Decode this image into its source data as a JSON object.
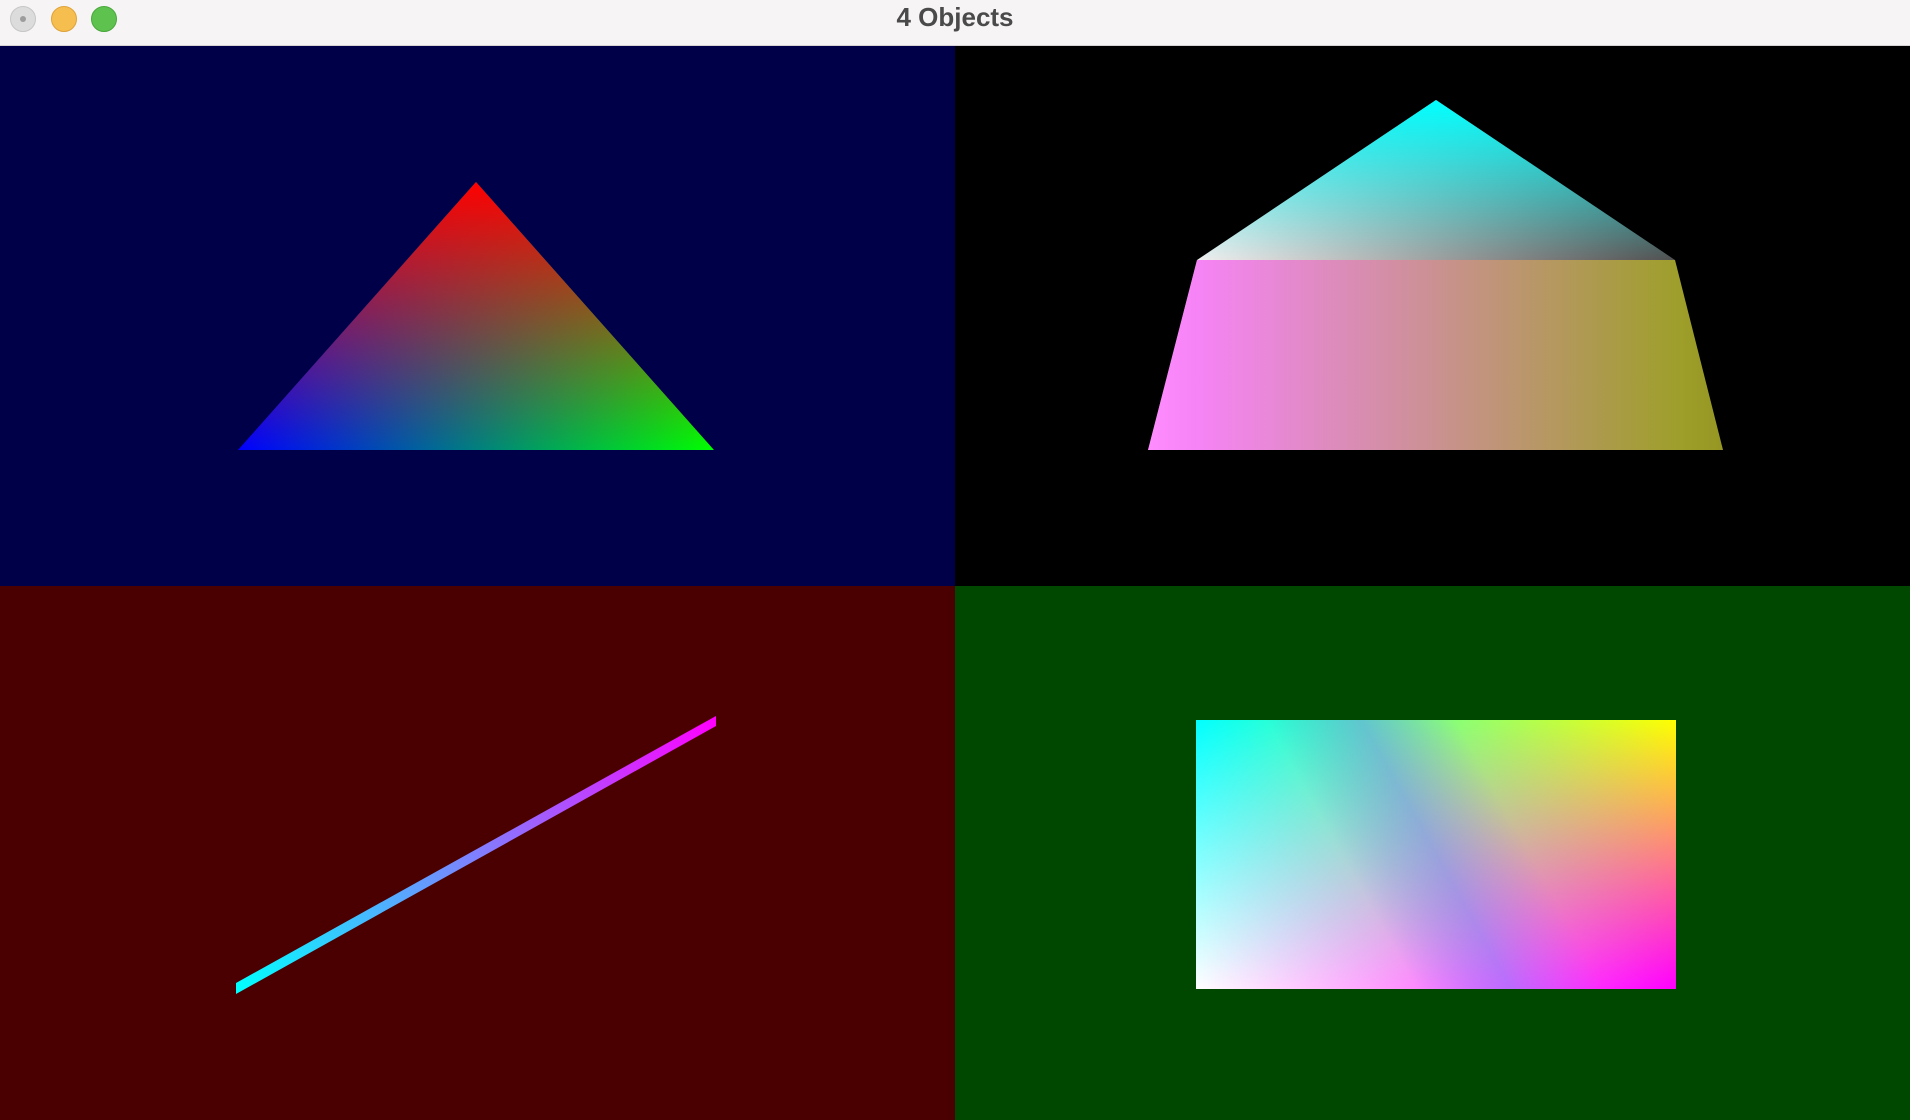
{
  "window": {
    "title": "4 Objects"
  },
  "viewports": [
    {
      "name": "triangle",
      "background": "#000048",
      "shape": "triangle",
      "vertex_colors": [
        "#ff0000",
        "#0000ff",
        "#00ff00"
      ]
    },
    {
      "name": "pentagon",
      "background": "#000000",
      "shape": "pentagon",
      "vertex_colors": [
        "#00ffff",
        "#ff00ff",
        "#ffff00",
        "#ffffff",
        "#404040"
      ]
    },
    {
      "name": "line",
      "background": "#4a0000",
      "shape": "line",
      "vertex_colors": [
        "#00ffff",
        "#ff00ff"
      ]
    },
    {
      "name": "rectangle",
      "background": "#004800",
      "shape": "rectangle",
      "vertex_colors": [
        "#00ffff",
        "#ffff00",
        "#ffffff",
        "#ff00ff"
      ]
    }
  ]
}
